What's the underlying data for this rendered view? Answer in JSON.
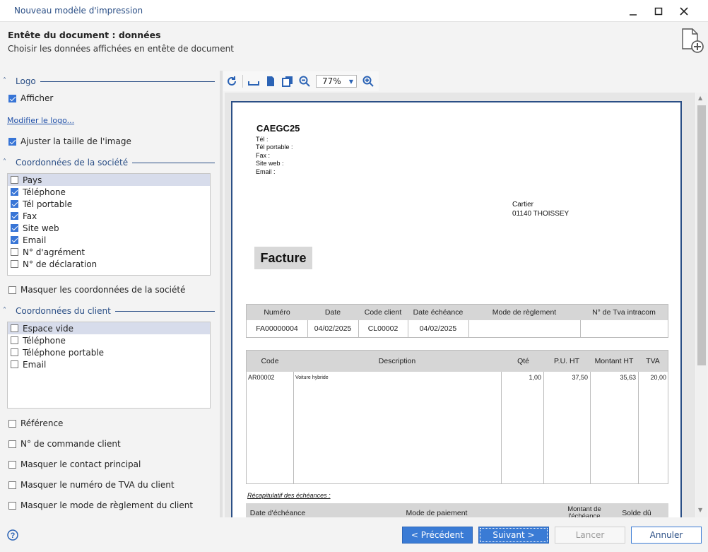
{
  "window": {
    "title": "Nouveau modèle d'impression"
  },
  "header": {
    "title": "Entête du document : données",
    "subtitle": "Choisir les données affichées en entête de document"
  },
  "logo": {
    "section": "Logo",
    "show_label": "Afficher",
    "show_checked": true,
    "modify_link": "Modifier le logo...",
    "adjust_label": "Ajuster la taille de l'image",
    "adjust_checked": true
  },
  "company": {
    "section": "Coordonnées de la société",
    "items": [
      {
        "label": "Pays",
        "checked": false
      },
      {
        "label": "Téléphone",
        "checked": true
      },
      {
        "label": "Tél portable",
        "checked": true
      },
      {
        "label": "Fax",
        "checked": true
      },
      {
        "label": "Site web",
        "checked": true
      },
      {
        "label": "Email",
        "checked": true
      },
      {
        "label": "N° d'agrément",
        "checked": false
      },
      {
        "label": "N° de déclaration",
        "checked": false
      }
    ],
    "hide_label": "Masquer les coordonnées de la société"
  },
  "client": {
    "section": "Coordonnées du client",
    "items": [
      {
        "label": "Espace vide",
        "checked": false
      },
      {
        "label": "Téléphone",
        "checked": false
      },
      {
        "label": "Téléphone portable",
        "checked": false
      },
      {
        "label": "Email",
        "checked": false
      }
    ],
    "options": [
      "Référence",
      "N° de commande client",
      "Masquer le contact principal",
      "Masquer le numéro de TVA du client",
      "Masquer le mode de règlement du client"
    ]
  },
  "toolbar": {
    "zoom": "77%"
  },
  "doc": {
    "company_name": "CAEGC25",
    "company_lines": [
      "Tél :",
      "Tél portable :",
      "Fax :",
      "Site web :",
      "Email :"
    ],
    "client_name": "Cartier",
    "client_city": "01140 THOISSEY",
    "title": "Facture",
    "head_cols": [
      "Numéro",
      "Date",
      "Code client",
      "Date échéance",
      "Mode de règlement",
      "N° de Tva intracom"
    ],
    "head_vals": [
      "FA00000004",
      "04/02/2025",
      "CL00002",
      "04/02/2025",
      "",
      ""
    ],
    "line_cols": [
      "Code",
      "Description",
      "Qté",
      "P.U. HT",
      "Montant HT",
      "TVA"
    ],
    "line_vals": [
      "AR00002",
      "Voiture hybride",
      "1,00",
      "37,50",
      "35,63",
      "20,00"
    ],
    "recap_title": "Récapitulatif des échéances :",
    "recap_cols": [
      "Date d'échéance",
      "Mode de paiement",
      "Montant de l'échéance",
      "Solde dû"
    ]
  },
  "footer": {
    "prev": "< Précédent",
    "next": "Suivant >",
    "launch": "Lancer",
    "cancel": "Annuler"
  }
}
